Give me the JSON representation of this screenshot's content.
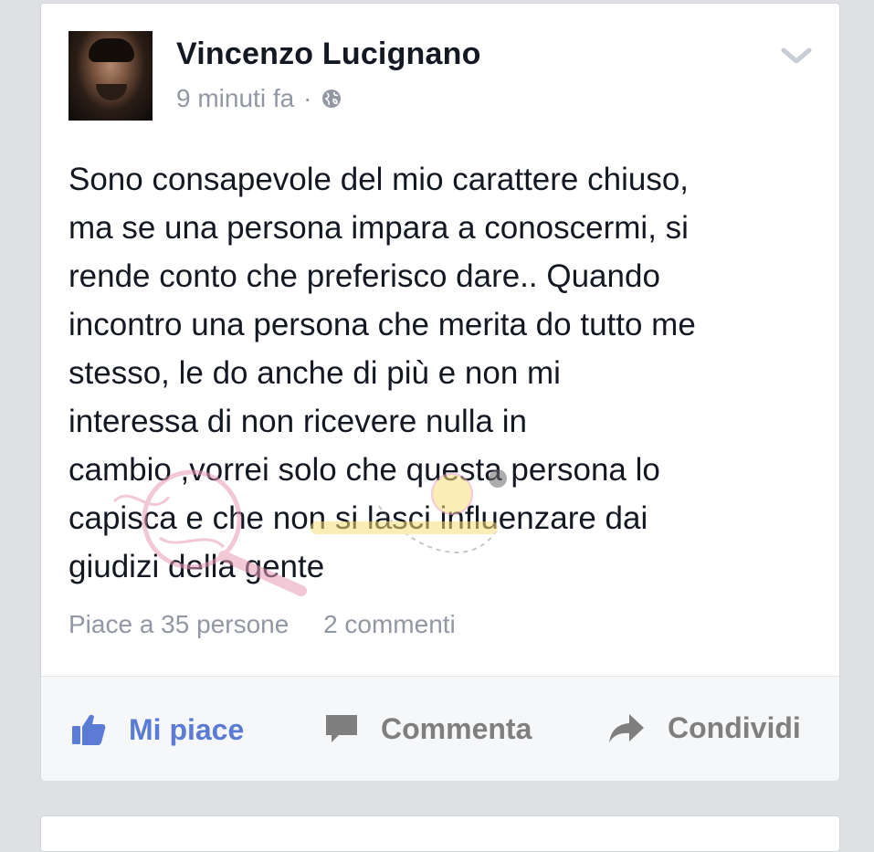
{
  "post": {
    "author": "Vincenzo Lucignano",
    "time": "9 minuti fa",
    "separator": "·",
    "privacy_icon": "globe-icon",
    "menu_icon": "chevron-down-icon",
    "text": "Sono consapevole del mio carattere chiuso,\nma se una persona impara a conoscermi, si\nrende conto che preferisco dare.. Quando\nincontro una persona che merita do tutto me\nstesso,  le do anche di più e non mi\ninteressa di non ricevere nulla in\ncambio ,vorrei solo che questa persona lo\ncapisca  e che non si lasci influenzare dai\ngiudizi della gente",
    "likes_text": "Piace a 35 persone",
    "comments_text": "2 commenti"
  },
  "actions": {
    "like_label": "Mi piace",
    "like_icon": "thumbs-up-icon",
    "comment_label": "Commenta",
    "comment_icon": "comment-bubble-icon",
    "share_label": "Condividi",
    "share_icon": "share-arrow-icon"
  },
  "colors": {
    "background": "#dfe0e4",
    "card": "#ffffff",
    "author_text": "#141823",
    "meta_text": "#9197a3",
    "like_accent": "#5b7bd5",
    "action_text": "#7f7f7f",
    "action_bar_bg": "#f6f7f9"
  }
}
